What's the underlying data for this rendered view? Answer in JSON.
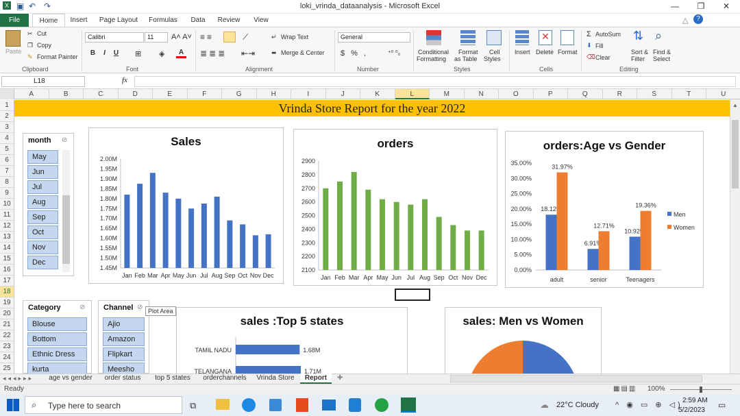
{
  "window": {
    "title": "loki_vrinda_dataanalysis  -  Microsoft Excel"
  },
  "ribbon_tabs": [
    "File",
    "Home",
    "Insert",
    "Page Layout",
    "Formulas",
    "Data",
    "Review",
    "View"
  ],
  "clipboard": {
    "paste": "Paste",
    "cut": "Cut",
    "copy": "Copy",
    "format_painter": "Format Painter",
    "group": "Clipboard"
  },
  "font": {
    "name": "Calibri",
    "size": "11",
    "group": "Font"
  },
  "alignment": {
    "wrap": "Wrap Text",
    "merge": "Merge & Center",
    "group": "Alignment"
  },
  "number": {
    "format": "General",
    "group": "Number"
  },
  "styles": {
    "cond": "Conditional",
    "cond2": "Formatting",
    "table": "Format",
    "table2": "as Table",
    "cell": "Cell",
    "cell2": "Styles",
    "group": "Styles"
  },
  "cells": {
    "insert": "Insert",
    "delete": "Delete",
    "format": "Format",
    "group": "Cells"
  },
  "editing": {
    "autosum": "AutoSum",
    "fill": "Fill",
    "clear": "Clear",
    "sort": "Sort &",
    "sort2": "Filter",
    "find": "Find &",
    "find2": "Select",
    "group": "Editing"
  },
  "formula_bar": {
    "cell": "L18",
    "fx": "fx",
    "value": ""
  },
  "columns": [
    "A",
    "B",
    "C",
    "D",
    "E",
    "F",
    "G",
    "H",
    "I",
    "J",
    "K",
    "L",
    "M",
    "N",
    "O",
    "P",
    "Q",
    "R",
    "S",
    "T",
    "U"
  ],
  "rows": [
    "1",
    "2",
    "3",
    "4",
    "5",
    "6",
    "7",
    "8",
    "9",
    "10",
    "11",
    "12",
    "13",
    "14",
    "15",
    "16",
    "17",
    "18",
    "19",
    "20",
    "21",
    "22",
    "23",
    "24",
    "25"
  ],
  "banner": "Vrinda Store Report for the year 2022",
  "slicers": {
    "month": {
      "title": "month",
      "items": [
        "May",
        "Jun",
        "Jul",
        "Aug",
        "Sep",
        "Oct",
        "Nov",
        "Dec"
      ]
    },
    "category": {
      "title": "Category",
      "items": [
        "Blouse",
        "Bottom",
        "Ethnic Dress",
        "kurta"
      ]
    },
    "channel": {
      "title": "Channel",
      "items": [
        "Ajio",
        "Amazon",
        "Flipkart",
        "Meesho"
      ]
    }
  },
  "tooltip": "Plot Area",
  "chart_data": [
    {
      "type": "bar",
      "title": "Sales",
      "categories": [
        "Jan",
        "Feb",
        "Mar",
        "Apr",
        "May",
        "Jun",
        "Jul",
        "Aug",
        "Sep",
        "Oct",
        "Nov",
        "Dec"
      ],
      "values": [
        1.82,
        1.875,
        1.93,
        1.83,
        1.8,
        1.75,
        1.775,
        1.81,
        1.69,
        1.67,
        1.615,
        1.62
      ],
      "yticks": [
        "1.45M",
        "1.50M",
        "1.55M",
        "1.60M",
        "1.65M",
        "1.70M",
        "1.75M",
        "1.80M",
        "1.85M",
        "1.90M",
        "1.95M",
        "2.00M"
      ],
      "ylim": [
        1.45,
        2.0
      ],
      "color": "#4472c4"
    },
    {
      "type": "bar",
      "title": "orders",
      "categories": [
        "Jan",
        "Feb",
        "Mar",
        "Apr",
        "May",
        "Jun",
        "Jul",
        "Aug",
        "Sep",
        "Oct",
        "Nov",
        "Dec"
      ],
      "values": [
        2700,
        2750,
        2820,
        2690,
        2620,
        2600,
        2580,
        2620,
        2490,
        2430,
        2390,
        2390
      ],
      "yticks": [
        "2100",
        "2200",
        "2300",
        "2400",
        "2500",
        "2600",
        "2700",
        "2800",
        "2900"
      ],
      "ylim": [
        2100,
        2900
      ],
      "color": "#70ad47"
    },
    {
      "type": "bar",
      "title": "orders:Age vs Gender",
      "categories": [
        "adult",
        "senior",
        "Teenagers"
      ],
      "series": [
        {
          "name": "Men",
          "values": [
            18.12,
            6.91,
            10.92
          ],
          "labels": [
            "18.12%",
            "6.91%",
            "10.92%"
          ],
          "color": "#4472c4"
        },
        {
          "name": "Women",
          "values": [
            31.97,
            12.71,
            19.36
          ],
          "labels": [
            "31.97%",
            "12.71%",
            "19.36%"
          ],
          "color": "#ed7d31"
        }
      ],
      "yticks": [
        "0.00%",
        "5.00%",
        "10.00%",
        "15.00%",
        "20.00%",
        "25.00%",
        "30.00%",
        "35.00%"
      ],
      "ylim": [
        0,
        35
      ]
    },
    {
      "type": "bar",
      "title": "sales :Top 5 states",
      "categories": [
        "TAMIL NADU",
        "TELANGANA"
      ],
      "values": [
        1.68,
        1.71
      ],
      "labels": [
        "1.68M",
        "1.71M"
      ],
      "color": "#4472c4"
    },
    {
      "type": "pie",
      "title": "sales: Men vs Women",
      "colors": [
        "#4472c4",
        "#ed7d31"
      ]
    }
  ],
  "sheet_tabs": [
    "age vs gender",
    "order status",
    "top 5 states",
    "orderchannels",
    "Vrinda Store",
    "Report"
  ],
  "status": {
    "ready": "Ready",
    "zoom": "100%"
  },
  "taskbar": {
    "search": "Type here to search",
    "weather": "22°C  Cloudy",
    "time": "2:59 AM",
    "date": "5/2/2023"
  }
}
